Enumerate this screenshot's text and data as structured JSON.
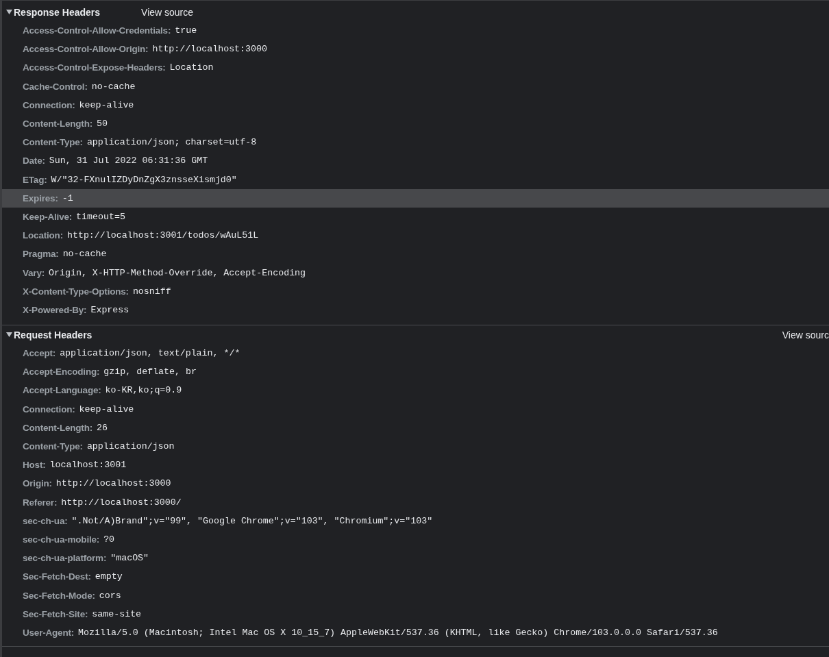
{
  "sections": [
    {
      "title": "Response Headers",
      "view_source": "View source",
      "expanded": true,
      "headers": [
        {
          "name": "Access-Control-Allow-Credentials:",
          "value": "true",
          "selected": false
        },
        {
          "name": "Access-Control-Allow-Origin:",
          "value": "http://localhost:3000",
          "selected": false
        },
        {
          "name": "Access-Control-Expose-Headers:",
          "value": "Location",
          "selected": false
        },
        {
          "name": "Cache-Control:",
          "value": "no-cache",
          "selected": false
        },
        {
          "name": "Connection:",
          "value": "keep-alive",
          "selected": false
        },
        {
          "name": "Content-Length:",
          "value": "50",
          "selected": false
        },
        {
          "name": "Content-Type:",
          "value": "application/json; charset=utf-8",
          "selected": false
        },
        {
          "name": "Date:",
          "value": "Sun, 31 Jul 2022 06:31:36 GMT",
          "selected": false
        },
        {
          "name": "ETag:",
          "value": "W/\"32-FXnulIZDyDnZgX3znsseXismjd0\"",
          "selected": false
        },
        {
          "name": "Expires:",
          "value": "-1",
          "selected": true
        },
        {
          "name": "Keep-Alive:",
          "value": "timeout=5",
          "selected": false
        },
        {
          "name": "Location:",
          "value": "http://localhost:3001/todos/wAuL51L",
          "selected": false
        },
        {
          "name": "Pragma:",
          "value": "no-cache",
          "selected": false
        },
        {
          "name": "Vary:",
          "value": "Origin, X-HTTP-Method-Override, Accept-Encoding",
          "selected": false
        },
        {
          "name": "X-Content-Type-Options:",
          "value": "nosniff",
          "selected": false
        },
        {
          "name": "X-Powered-By:",
          "value": "Express",
          "selected": false
        }
      ]
    },
    {
      "title": "Request Headers",
      "view_source": "View sourc",
      "expanded": true,
      "headers": [
        {
          "name": "Accept:",
          "value": "application/json, text/plain, */*",
          "selected": false
        },
        {
          "name": "Accept-Encoding:",
          "value": "gzip, deflate, br",
          "selected": false
        },
        {
          "name": "Accept-Language:",
          "value": "ko-KR,ko;q=0.9",
          "selected": false
        },
        {
          "name": "Connection:",
          "value": "keep-alive",
          "selected": false
        },
        {
          "name": "Content-Length:",
          "value": "26",
          "selected": false
        },
        {
          "name": "Content-Type:",
          "value": "application/json",
          "selected": false
        },
        {
          "name": "Host:",
          "value": "localhost:3001",
          "selected": false
        },
        {
          "name": "Origin:",
          "value": "http://localhost:3000",
          "selected": false
        },
        {
          "name": "Referer:",
          "value": "http://localhost:3000/",
          "selected": false
        },
        {
          "name": "sec-ch-ua:",
          "value": "\".Not/A)Brand\";v=\"99\", \"Google Chrome\";v=\"103\", \"Chromium\";v=\"103\"",
          "selected": false
        },
        {
          "name": "sec-ch-ua-mobile:",
          "value": "?0",
          "selected": false
        },
        {
          "name": "sec-ch-ua-platform:",
          "value": "\"macOS\"",
          "selected": false
        },
        {
          "name": "Sec-Fetch-Dest:",
          "value": "empty",
          "selected": false
        },
        {
          "name": "Sec-Fetch-Mode:",
          "value": "cors",
          "selected": false
        },
        {
          "name": "Sec-Fetch-Site:",
          "value": "same-site",
          "selected": false
        },
        {
          "name": "User-Agent:",
          "value": "Mozilla/5.0 (Macintosh; Intel Mac OS X 10_15_7) AppleWebKit/537.36 (KHTML, like Gecko) Chrome/103.0.0.0 Safari/537.36",
          "selected": false
        }
      ]
    }
  ]
}
